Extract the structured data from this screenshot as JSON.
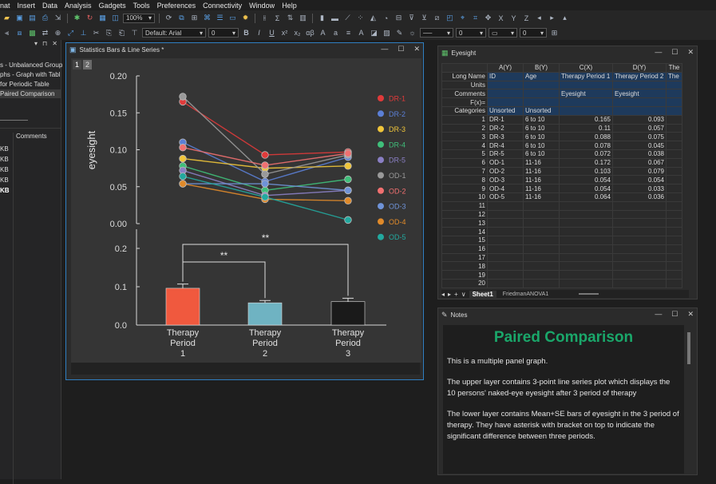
{
  "menu": [
    "nat",
    "Insert",
    "Data",
    "Analysis",
    "Gadgets",
    "Tools",
    "Preferences",
    "Connectivity",
    "Window",
    "Help"
  ],
  "toolbar": {
    "zoom": "100%",
    "font": "Default: Arial",
    "font_size": "0"
  },
  "left_panel": {
    "tree_items": [
      "s - Unbalanced Group",
      "phs - Graph with Tabl",
      " for Periodic Table",
      " Paired Comparison"
    ],
    "selected_index": 3,
    "columns_header": "Comments",
    "size_items": [
      "KB",
      "KB",
      "KB",
      "KB",
      "KB"
    ]
  },
  "graph_window": {
    "title": "Statistics Bars & Line Series *",
    "layer_tabs": [
      "1",
      "2"
    ]
  },
  "worksheet_window": {
    "title": "Eyesight",
    "col_headers": [
      "A(Y)",
      "B(Y)",
      "C(X)",
      "D(Y)",
      "The"
    ],
    "label_rows": [
      {
        "label": "Long Name",
        "cells": [
          "ID",
          "Age",
          "Therapy Period 1",
          "Therapy Period 2",
          "The"
        ]
      },
      {
        "label": "Units",
        "cells": [
          "",
          "",
          "",
          "",
          ""
        ]
      },
      {
        "label": "Comments",
        "cells": [
          "",
          "",
          "Eyesight",
          "Eyesight",
          ""
        ]
      },
      {
        "label": "F(x)=",
        "cells": [
          "",
          "",
          "",
          "",
          ""
        ]
      },
      {
        "label": "Categories",
        "cells": [
          "Unsorted",
          "Unsorted",
          "",
          "",
          ""
        ]
      }
    ],
    "rows": [
      [
        "1",
        "DR-1",
        "6 to 10",
        "0.165",
        "0.093"
      ],
      [
        "2",
        "DR-2",
        "6 to 10",
        "0.11",
        "0.057"
      ],
      [
        "3",
        "DR-3",
        "6 to 10",
        "0.088",
        "0.075"
      ],
      [
        "4",
        "DR-4",
        "6 to 10",
        "0.078",
        "0.045"
      ],
      [
        "5",
        "DR-5",
        "6 to 10",
        "0.072",
        "0.038"
      ],
      [
        "6",
        "OD-1",
        "11-16",
        "0.172",
        "0.067"
      ],
      [
        "7",
        "OD-2",
        "11-16",
        "0.103",
        "0.079"
      ],
      [
        "8",
        "OD-3",
        "11-16",
        "0.054",
        "0.054"
      ],
      [
        "9",
        "OD-4",
        "11-16",
        "0.054",
        "0.033"
      ],
      [
        "10",
        "OD-5",
        "11-16",
        "0.064",
        "0.036"
      ],
      [
        "11",
        "",
        "",
        "",
        ""
      ],
      [
        "12",
        "",
        "",
        "",
        ""
      ],
      [
        "13",
        "",
        "",
        "",
        ""
      ],
      [
        "14",
        "",
        "",
        "",
        ""
      ],
      [
        "15",
        "",
        "",
        "",
        ""
      ],
      [
        "16",
        "",
        "",
        "",
        ""
      ],
      [
        "17",
        "",
        "",
        "",
        ""
      ],
      [
        "18",
        "",
        "",
        "",
        ""
      ],
      [
        "19",
        "",
        "",
        "",
        ""
      ],
      [
        "20",
        "",
        "",
        "",
        ""
      ]
    ],
    "sheet_tabs": [
      "Sheet1",
      "FriedmanANOVA1"
    ]
  },
  "notes_window": {
    "title": "Notes",
    "heading": "Paired Comparison",
    "paragraphs": [
      "This is a multiple panel graph.",
      "The upper layer contains  3-point line series plot which displays the 10 persons' naked-eye eyesight after 3 period of therapy",
      "The lower layer contains Mean+SE bars of eyesight in the 3 period of therapy. They have asterisk with bracket on top to indicate the significant difference between three periods."
    ],
    "heading_color": "#1aa76a"
  },
  "chart_data": [
    {
      "type": "line",
      "x": [
        "Therapy Period 1",
        "Therapy Period 2",
        "Therapy Period 3"
      ],
      "ylabel": "eyesight",
      "ylim": [
        0,
        0.2
      ],
      "yticks": [
        "0.00",
        "0.05",
        "0.10",
        "0.15",
        "0.20"
      ],
      "series": [
        {
          "name": "DR-1",
          "color": "#e03a3a",
          "values": [
            0.165,
            0.093,
            0.097
          ]
        },
        {
          "name": "DR-2",
          "color": "#5b7fd6",
          "values": [
            0.11,
            0.057,
            0.09
          ]
        },
        {
          "name": "DR-3",
          "color": "#f0c53a",
          "values": [
            0.088,
            0.075,
            0.078
          ]
        },
        {
          "name": "DR-4",
          "color": "#3fbf7a",
          "values": [
            0.078,
            0.045,
            0.06
          ]
        },
        {
          "name": "DR-5",
          "color": "#8a7fc4",
          "values": [
            0.072,
            0.038,
            0.045
          ]
        },
        {
          "name": "OD-1",
          "color": "#9a9a9a",
          "values": [
            0.172,
            0.067,
            0.093
          ]
        },
        {
          "name": "OD-2",
          "color": "#f07070",
          "values": [
            0.103,
            0.079,
            0.095
          ]
        },
        {
          "name": "OD-3",
          "color": "#6f93d8",
          "values": [
            0.054,
            0.054,
            0.045
          ]
        },
        {
          "name": "OD-4",
          "color": "#e08a2a",
          "values": [
            0.054,
            0.033,
            0.031
          ]
        },
        {
          "name": "OD-5",
          "color": "#22a99f",
          "values": [
            0.064,
            0.036,
            0.005
          ]
        }
      ],
      "legend_position": "right"
    },
    {
      "type": "bar",
      "categories": [
        "Therapy\nPeriod\n1",
        "Therapy\nPeriod\n2",
        "Therapy\nPeriod\n3"
      ],
      "values": [
        0.096,
        0.058,
        0.061
      ],
      "errors": [
        0.011,
        0.006,
        0.009
      ],
      "colors": [
        "#f0593e",
        "#6fb3c2",
        "#1a1a1a"
      ],
      "ylim": [
        0,
        0.25
      ],
      "yticks": [
        "0.0",
        "0.1",
        "0.2"
      ],
      "annotations": [
        "**",
        "**"
      ]
    }
  ]
}
